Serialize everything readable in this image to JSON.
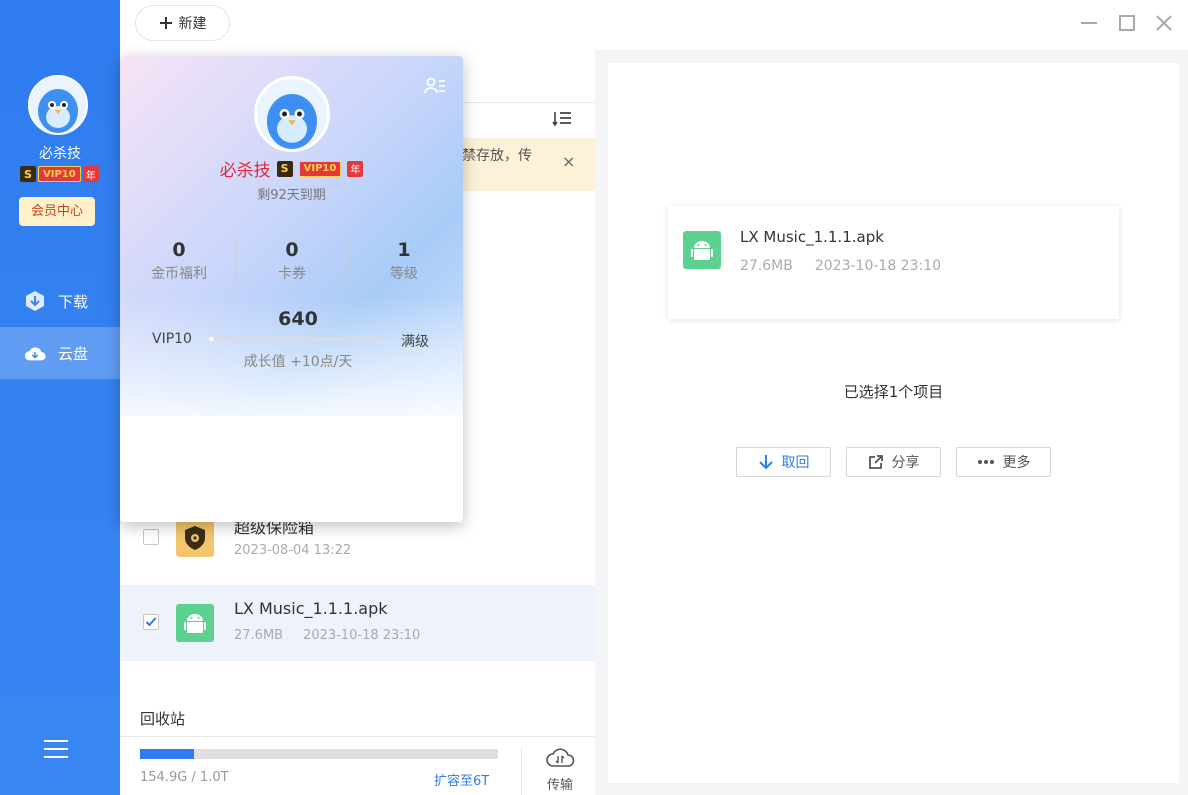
{
  "sidebar": {
    "username": "必杀技",
    "vip_s": "S",
    "vip_label": "VIP10",
    "vip_year": "年",
    "member_center": "会员中心",
    "nav": [
      {
        "label": "下载",
        "icon": "download-icon"
      },
      {
        "label": "云盘",
        "icon": "cloud-drive-icon"
      }
    ],
    "menu_icon": "hamburger-menu-icon"
  },
  "toolbar": {
    "new_label": "新建",
    "window_controls": [
      "minimize-icon",
      "maximize-icon",
      "close-icon"
    ]
  },
  "notice": {
    "text": "禁存放，传"
  },
  "files": [
    {
      "name": "超级保险箱",
      "date": "2023-08-04 13:22",
      "size": "",
      "icon": "safe-box-icon",
      "checked": false
    },
    {
      "name": "LX Music_1.1.1.apk",
      "date": "2023-10-18 23:10",
      "size": "27.6MB",
      "icon": "android-apk-icon",
      "checked": true
    }
  ],
  "recycle_bin": "回收站",
  "storage": {
    "used_text": "154.9G / 1.0T",
    "used_fraction": 0.15,
    "expand_label": "扩容至6T",
    "transfer_label": "传输"
  },
  "detail": {
    "file_name": "LX Music_1.1.1.apk",
    "file_size": "27.6MB",
    "file_date": "2023-10-18 23:10",
    "selected_text": "已选择1个项目",
    "actions": {
      "retrieve": "取回",
      "share": "分享",
      "more": "更多"
    }
  },
  "popup": {
    "name": "必杀技",
    "vip_label": "VIP10",
    "vip_year": "年",
    "expire_text": "剩92天到期",
    "stats": [
      {
        "value": "0",
        "label": "金币福利"
      },
      {
        "value": "0",
        "label": "卡券"
      },
      {
        "value": "1",
        "label": "等级"
      }
    ],
    "growth_value": "640",
    "vip_start": "VIP10",
    "vip_end": "满级",
    "growth_fraction": 0.03,
    "growth_rate": "成长值 +10点/天"
  },
  "colors": {
    "accent": "#2f7cf0",
    "vip_name": "#e0283a",
    "notice_bg": "#fdf1d8"
  }
}
